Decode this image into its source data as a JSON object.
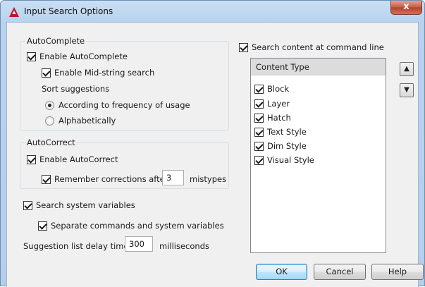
{
  "window": {
    "title": "Input Search Options",
    "close_label": "x"
  },
  "autocomplete": {
    "group_label": "AutoComplete",
    "enable_label": "Enable AutoComplete",
    "midstring_label": "Enable Mid-string search",
    "sort_label": "Sort suggestions",
    "options": [
      "According to frequency of usage",
      "Alphabetically"
    ],
    "selected_option": "According to frequency of usage"
  },
  "autocorrect": {
    "group_label": "AutoCorrect",
    "enable_label": "Enable AutoCorrect",
    "remember_label": "Remember corrections after",
    "remember_count": "3",
    "mistypes_label": "mistypes"
  },
  "sysvars": {
    "search_label": "Search system variables",
    "separate_label": "Separate commands and system variables"
  },
  "delay": {
    "label": "Suggestion list delay time",
    "value": "300",
    "unit": "milliseconds"
  },
  "content": {
    "search_label": "Search content at command line",
    "header": "Content Type",
    "items": [
      "Block",
      "Layer",
      "Hatch",
      "Text Style",
      "Dim Style",
      "Visual Style"
    ]
  },
  "buttons": {
    "ok": "OK",
    "cancel": "Cancel",
    "help": "Help"
  },
  "icons": {
    "up": "arrow-up-icon",
    "down": "arrow-down-icon",
    "app": "autocad-logo-icon"
  },
  "colors": {
    "accent": "#c9def3",
    "logo_red": "#c8102e"
  }
}
